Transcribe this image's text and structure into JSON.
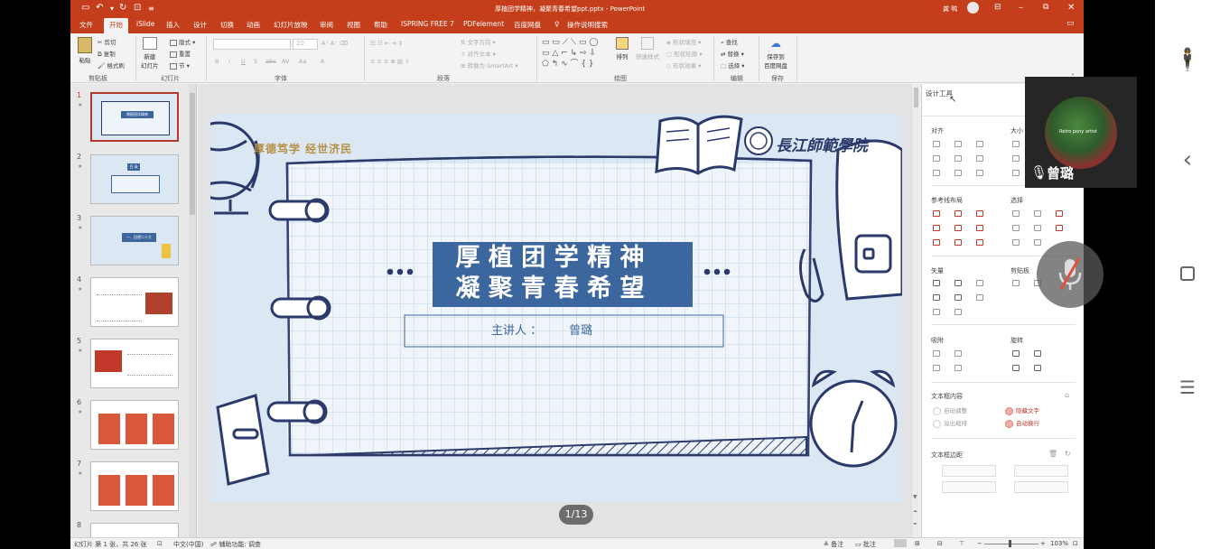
{
  "window": {
    "title": "厚植团学精神，凝聚青春希望ppt.pptx  -  PowerPoint",
    "user": "龚 鸭",
    "qat_icons": [
      "save-icon",
      "undo-icon",
      "redo-icon",
      "present-icon",
      "customize-icon"
    ]
  },
  "tabs": [
    "文件",
    "开始",
    "iSlide",
    "插入",
    "设计",
    "切换",
    "动画",
    "幻灯片放映",
    "审阅",
    "视图",
    "帮助",
    "ISPRING FREE 7",
    "PDFelement",
    "百度网盘",
    "操作说明搜索"
  ],
  "active_tab": "开始",
  "ribbon": {
    "clipboard": {
      "label": "剪贴板",
      "paste": "粘贴",
      "cut": "剪切",
      "copy": "复制",
      "format_painter": "格式刷"
    },
    "slides": {
      "label": "幻灯片",
      "new_slide": "新建\n幻灯片",
      "layout": "版式",
      "reset": "重置",
      "section": "节"
    },
    "font": {
      "label": "字体",
      "size_placeholder": "20",
      "buttons": [
        "B",
        "I",
        "U",
        "S",
        "abc",
        "AV",
        "Aa",
        "A"
      ]
    },
    "paragraph": {
      "label": "段落",
      "text_direction": "文字方向",
      "align_text": "对齐文本",
      "smartart": "转换为 SmartArt"
    },
    "drawing": {
      "label": "绘图",
      "arrange": "排列",
      "quick_styles": "快速样式",
      "fill": "形状填充",
      "outline": "形状轮廓",
      "effects": "形状效果"
    },
    "editing": {
      "label": "编辑",
      "find": "查找",
      "replace": "替换",
      "select": "选择"
    },
    "save": {
      "label": "保存",
      "save_to": "保存到\n百度网盘"
    }
  },
  "thumbnails": [
    {
      "num": "1",
      "title_text": "厚植团学精神"
    },
    {
      "num": "2",
      "title_text": "目 录"
    },
    {
      "num": "3",
      "title_text": "一、回望二十大"
    },
    {
      "num": "4",
      "title_text": ""
    },
    {
      "num": "5",
      "title_text": ""
    },
    {
      "num": "6",
      "title_text": ""
    },
    {
      "num": "7",
      "title_text": ""
    },
    {
      "num": "8",
      "title_text": ""
    }
  ],
  "slide": {
    "motto": "厚德笃学  经世济民",
    "university": "長江師範學院",
    "title_line1": "厚 植 团 学 精 神",
    "title_line2": "凝 聚 青 春 希 望",
    "presenter_label": "主讲人 ：",
    "presenter_name": "曾璐",
    "page_badge": "1/13"
  },
  "right_pane": {
    "title": "设计工具",
    "align": "对齐",
    "size": "大小",
    "guides": "参考线布局",
    "select": "选择",
    "vector": "矢量",
    "clipboard": "剪贴板",
    "snap": "吸附",
    "rotate": "旋转",
    "textbox_content": "文本框内容",
    "auto_adjust": "自动调整",
    "hide_text": "隐藏文字",
    "overflow_shrink": "溢出缩排",
    "auto_wrap": "自动换行",
    "textbox_margin": "文本框边距"
  },
  "statusbar": {
    "slide_info": "幻灯片 第 1 张，共 26 张",
    "language": "中文(中国)",
    "accessibility": "辅助功能: 调查",
    "notes": "备注",
    "comments": "批注",
    "zoom": "103%"
  },
  "video": {
    "speaker_name": "曾璐",
    "avatar_caption": "Retro pony artist"
  },
  "colors": {
    "accent": "#c43e1c",
    "slide_bg": "#dbe8f3",
    "title_box": "#3b669e",
    "ink": "#2b3a6b"
  }
}
